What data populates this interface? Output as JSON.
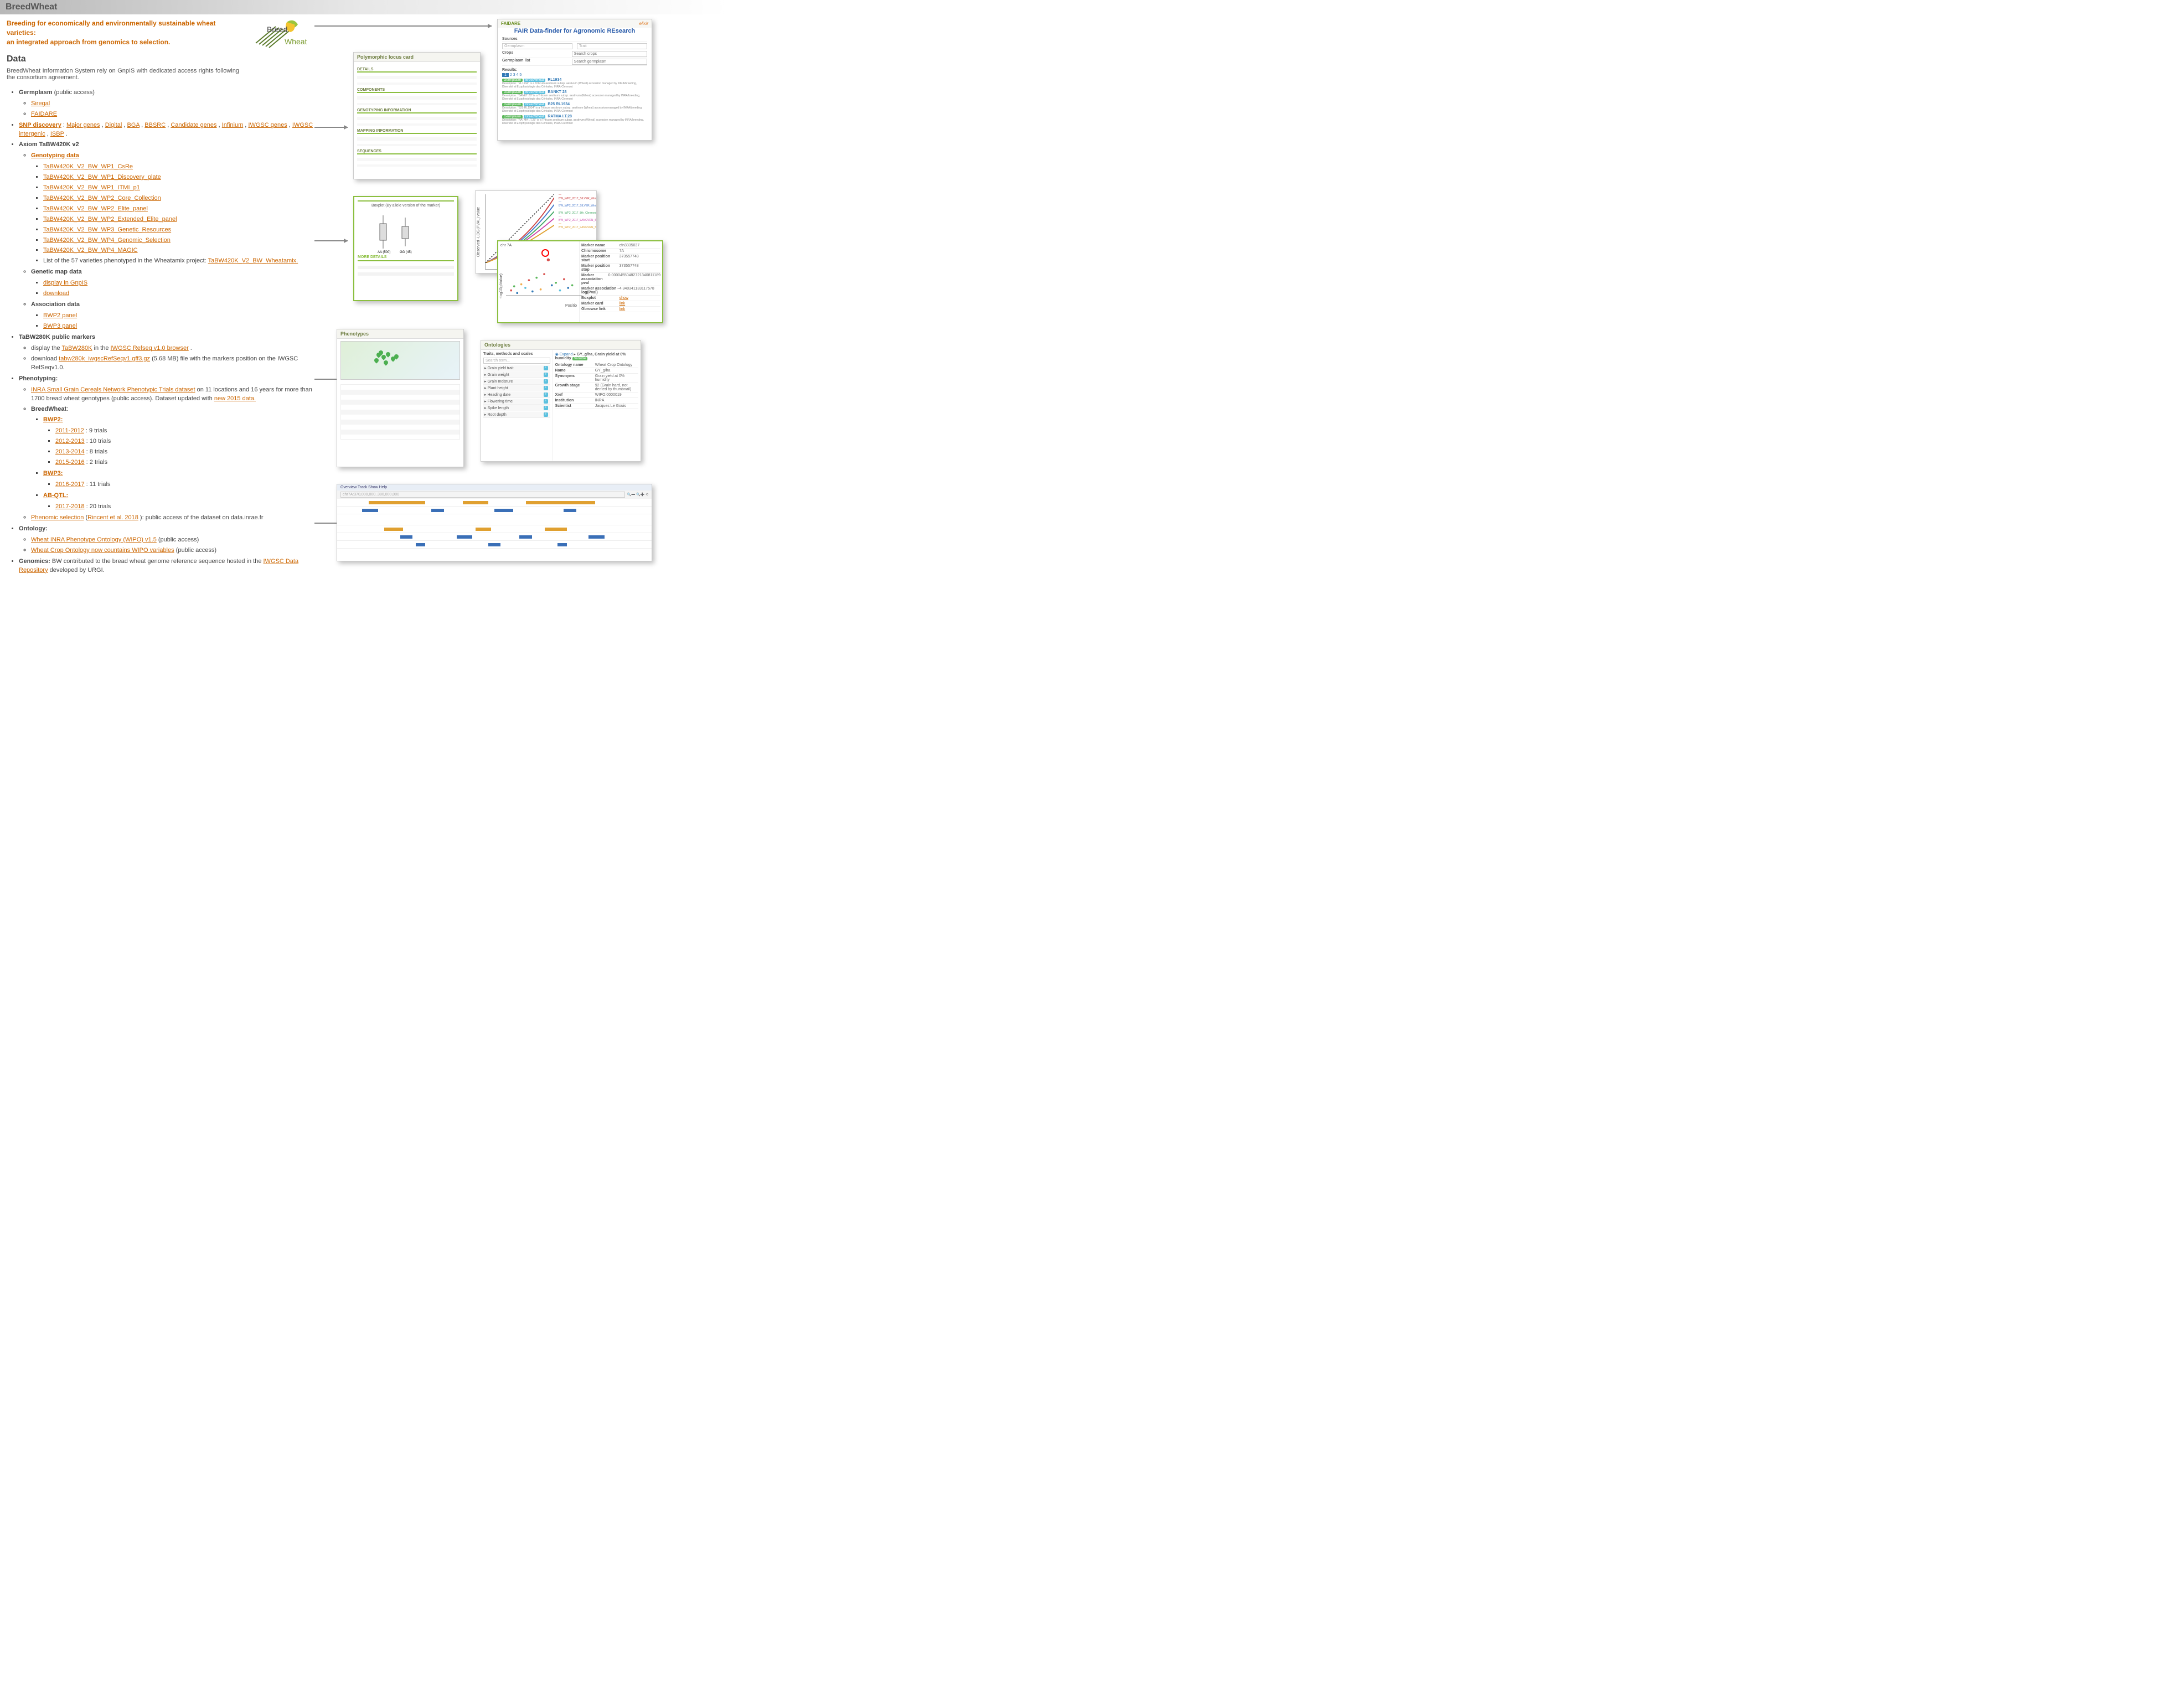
{
  "header": {
    "title": "BreedWheat"
  },
  "tagline": {
    "line1": "Breeding for economically and environmentally sustainable wheat varieties:",
    "line2": "an integrated approach from genomics to selection."
  },
  "logo": {
    "top_word": "Breed",
    "bottom_word": "Wheat"
  },
  "data_section": {
    "heading": "Data",
    "intro": "BreedWheat Information System rely on GnpIS with dedicated access rights following the consortium agreement."
  },
  "germplasm": {
    "label": "Germplasm",
    "suffix": " (public access)",
    "siregal": "Siregal",
    "faidare": "FAIDARE"
  },
  "snp": {
    "label": "SNP discovery",
    "sep": " : ",
    "items": [
      "Major genes",
      "Digital",
      "BGA",
      "BBSRC",
      "Candidate genes",
      "Infinium",
      "IWGSC genes",
      "IWGSC intergenic",
      "ISBP"
    ],
    "tail": " ."
  },
  "axiom": {
    "label": "Axiom TaBW420K v2",
    "genotyping": "Genotyping data",
    "genolinks": [
      "TaBW420K_V2_BW_WP1_CsRe",
      "TaBW420K_V2_BW_WP1_Discovery_plate",
      "TaBW420K_V2_BW_WP1_ITMI_p1",
      "TaBW420K_V2_BW_WP2_Core_Collection",
      "TaBW420K_V2_BW_WP2_Elite_panel",
      "TaBW420K_V2_BW_WP2_Extended_Elite_panel",
      "TaBW420K_V2_BW_WP3_Genetic_Resources",
      "TaBW420K_V2_BW_WP4_Genomic_Selection",
      "TaBW420K_V2_BW_WP4_MAGIC"
    ],
    "wheatamix_pre": "List of the 57 varieties phenotyped in the Wheatamix project: ",
    "wheatamix_link": "TaBW420K_V2_BW_Wheatamix.",
    "genetic_map": "Genetic map data",
    "map_display": "display in GnpIS",
    "map_download": "download",
    "assoc": "Association data",
    "bwp2": "BWP2 panel",
    "bwp3": "BWP3 panel"
  },
  "tabw280k": {
    "label": "TaBW280K public markers",
    "line1_pre": "display the ",
    "line1_link1": "TaBW280K",
    "line1_mid": " in the ",
    "line1_link2": "IWGSC Refseq v1.0 browser",
    "line1_tail": " .",
    "line2_pre": "download ",
    "line2_link": "tabw280k_iwgscRefSeqv1.gff3.gz",
    "line2_tail": " (5.68 MB) file with the markers position on the IWGSC RefSeqv1.0."
  },
  "phenotyping": {
    "label": "Phenotyping:",
    "inra_link": "INRA Small Grain Cereals Network Phenotypic Trials dataset",
    "inra_mid": " on 11 locations and 16 years for more than 1700 bread wheat genotypes (public access). Dataset updated with ",
    "inra_link2": "new 2015 data.",
    "breedwheat": "BreedWheat",
    "bwp2": "BWP2:",
    "bwp2_rows": [
      {
        "yr": "2011-2012",
        "txt": " : 9 trials"
      },
      {
        "yr": "2012-2013",
        "txt": " : 10 trials"
      },
      {
        "yr": "2013-2014",
        "txt": " : 8 trials"
      },
      {
        "yr": "2015-2016",
        "txt": " : 2 trials"
      }
    ],
    "bwp3": "BWP3:",
    "bwp3_rows": [
      {
        "yr": "2016-2017",
        "txt": " : 11 trials"
      }
    ],
    "abqtl": "AB-QTL:",
    "abqtl_rows": [
      {
        "yr": "2017-2018",
        "txt": " : 20 trials"
      }
    ],
    "phenomic_link": "Phenomic selection",
    "phenomic_cite": " (Rincent et al. 2018)",
    "phenomic_cite_link": "Rincent et al. 2018",
    "phenomic_tail": ": public access of the dataset on data.inrae.fr"
  },
  "ontology": {
    "label": "Ontology:",
    "l1": "Wheat INRA Phenotype Ontology (WIPO) v1.5",
    "l1_tail": " (public access)",
    "l2": "Wheat Crop Ontology now countains WIPO variables",
    "l2_tail": " (public access)"
  },
  "genomics": {
    "label": "Genomics:",
    "pre": " BW contributed to the bread wheat genome reference sequence hosted in the ",
    "link": "IWGSC Data Repository",
    "tail": " developed by URGI."
  },
  "thumbs": {
    "faidare": {
      "title": "FAIR Data-finder for Agronomic REsearch",
      "sources": "Sources",
      "germ": "Germplasm",
      "trait": "Trait",
      "crops": "Crops",
      "gplist": "Germplasm list",
      "results": "Results:",
      "rows": [
        {
          "tag1": "Germplasm",
          "tag2": "BreedWheat",
          "name": "RL1934"
        },
        {
          "tag1": "Germplasm",
          "tag2": "BreedWheat",
          "name": "BANKT 28"
        },
        {
          "tag1": "Germplasm",
          "tag2": "BreedWheat",
          "name": "B25 RL1934"
        },
        {
          "tag1": "Germplasm",
          "tag2": "BreedWheat",
          "name": "RATMA I.T.28"
        }
      ]
    },
    "locus": {
      "title": "Polymorphic locus card",
      "sections": [
        "DETAILS",
        "COMPONENTS",
        "GENOTYPING INFORMATION",
        "MAPPING INFORMATION",
        "SEQUENCES"
      ]
    },
    "boxplot": {
      "hint": "Boxplot (By allele version of the marker)",
      "more": "MORE DETAILS"
    },
    "qq": {
      "ylab": "Observed -LOG(PVAL) value"
    },
    "manhattan": {
      "head": "chr 7A",
      "ylab": "-log10(pValue)",
      "xlab": "Positio",
      "kv": [
        {
          "k": "Marker name",
          "v": "cfn3335037"
        },
        {
          "k": "Chromosome",
          "v": "7A"
        },
        {
          "k": "Marker position start",
          "v": "373557748"
        },
        {
          "k": "Marker position stop",
          "v": "373557748"
        },
        {
          "k": "Marker association pval",
          "v": "0.00004550482721340811189"
        },
        {
          "k": "Marker association -log(Pval)",
          "v": "4.340341133117578"
        },
        {
          "k": "Boxplot",
          "v": "show"
        },
        {
          "k": "Marker card",
          "v": "link"
        },
        {
          "k": "Gbrowse link",
          "v": "link"
        }
      ]
    },
    "pheno": {
      "title": "Phenotypes"
    },
    "ont": {
      "title": "Ontologies",
      "sub": "Traits, methods and scales",
      "var": "GY_g/ha, Grain yield at 0% humidity",
      "fields": [
        {
          "k": "Ontology name",
          "v": "Wheat Crop Ontology"
        },
        {
          "k": "Name",
          "v": "GY_g/ha"
        },
        {
          "k": "Synonyms",
          "v": "Grain yield at 0% humidity"
        },
        {
          "k": "Growth stage",
          "v": "92 (Grain hard, not dented by thumbnail)"
        },
        {
          "k": "Xref",
          "v": "WIPO:0000019"
        },
        {
          "k": "Institution",
          "v": "INRA"
        },
        {
          "k": "Scientist",
          "v": "Jacques Le Gouis"
        }
      ]
    },
    "gbrowse": {
      "toolbar": "Overview   Track   Show   Help"
    }
  }
}
